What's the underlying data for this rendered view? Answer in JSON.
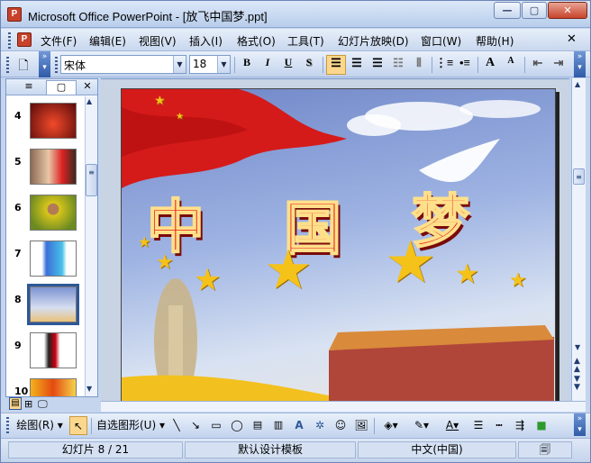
{
  "window": {
    "title": "Microsoft Office PowerPoint - [放飞中国梦.ppt]",
    "app_icon_letter": "P"
  },
  "menu": [
    "文件(F)",
    "编辑(E)",
    "视图(V)",
    "插入(I)",
    "格式(O)",
    "工具(T)",
    "幻灯片放映(D)",
    "窗口(W)",
    "帮助(H)"
  ],
  "toolbar": {
    "font_name": "宋体",
    "font_size": "18",
    "bold": "B",
    "italic": "I",
    "underline": "U",
    "shadow": "S",
    "increase_font": "A",
    "decrease_font": "A"
  },
  "slides_panel": {
    "tab_outline": "≡",
    "tab_slides": "▢",
    "close": "✕",
    "slides": [
      {
        "num": "4"
      },
      {
        "num": "5"
      },
      {
        "num": "6"
      },
      {
        "num": "7"
      },
      {
        "num": "8",
        "selected": true
      },
      {
        "num": "9"
      },
      {
        "num": "10"
      }
    ]
  },
  "slide": {
    "title_chars": [
      "中",
      "国",
      "梦"
    ]
  },
  "draw_toolbar": {
    "draw_label": "绘图(R)",
    "autoshapes_label": "自选图形(U)"
  },
  "status": {
    "slide_counter": "幻灯片 8 / 21",
    "template": "默认设计模板",
    "language": "中文(中国)"
  },
  "colors": {
    "accent": "#2d5797",
    "bar": "#c5d5ee",
    "title_red": "#e51515"
  }
}
